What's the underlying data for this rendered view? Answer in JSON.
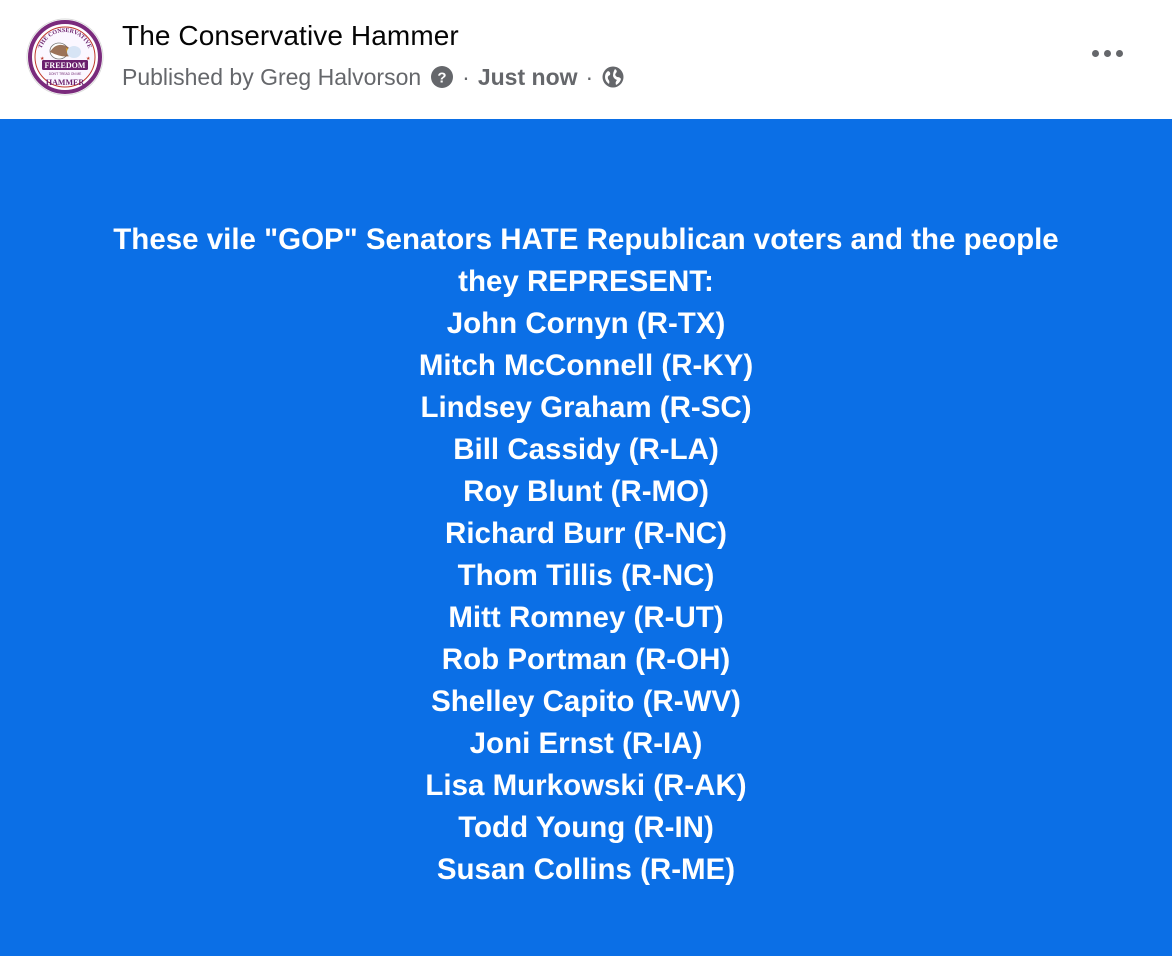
{
  "header": {
    "page_name": "The Conservative Hammer",
    "publisher": "Published by Greg Halvorson",
    "separator": "·",
    "time": "Just now",
    "icons": {
      "avatar": "page-logo",
      "help": "question-circle-icon",
      "audience": "globe-icon",
      "more": "more-horizontal-icon"
    }
  },
  "avatar_logo": {
    "top_text": "THE CONSERVATIVE",
    "middle_text": "FREEDOM",
    "motto": "DON'T TREAD ON ME",
    "bottom_text": "HAMMER"
  },
  "post": {
    "background_color": "#0b6fe6",
    "text_lines": [
      "These vile \"GOP\" Senators HATE Republican voters and the people",
      "they REPRESENT:",
      "John Cornyn (R-TX)",
      "Mitch McConnell (R-KY)",
      "Lindsey Graham (R-SC)",
      "Bill Cassidy (R-LA)",
      "Roy Blunt (R-MO)",
      "Richard Burr (R-NC)",
      "Thom Tillis (R-NC)",
      "Mitt Romney (R-UT)",
      "Rob Portman (R-OH)",
      "Shelley Capito (R-WV)",
      "Joni Ernst (R-IA)",
      "Lisa Murkowski (R-AK)",
      "Todd Young (R-IN)",
      "Susan Collins (R-ME)"
    ]
  }
}
